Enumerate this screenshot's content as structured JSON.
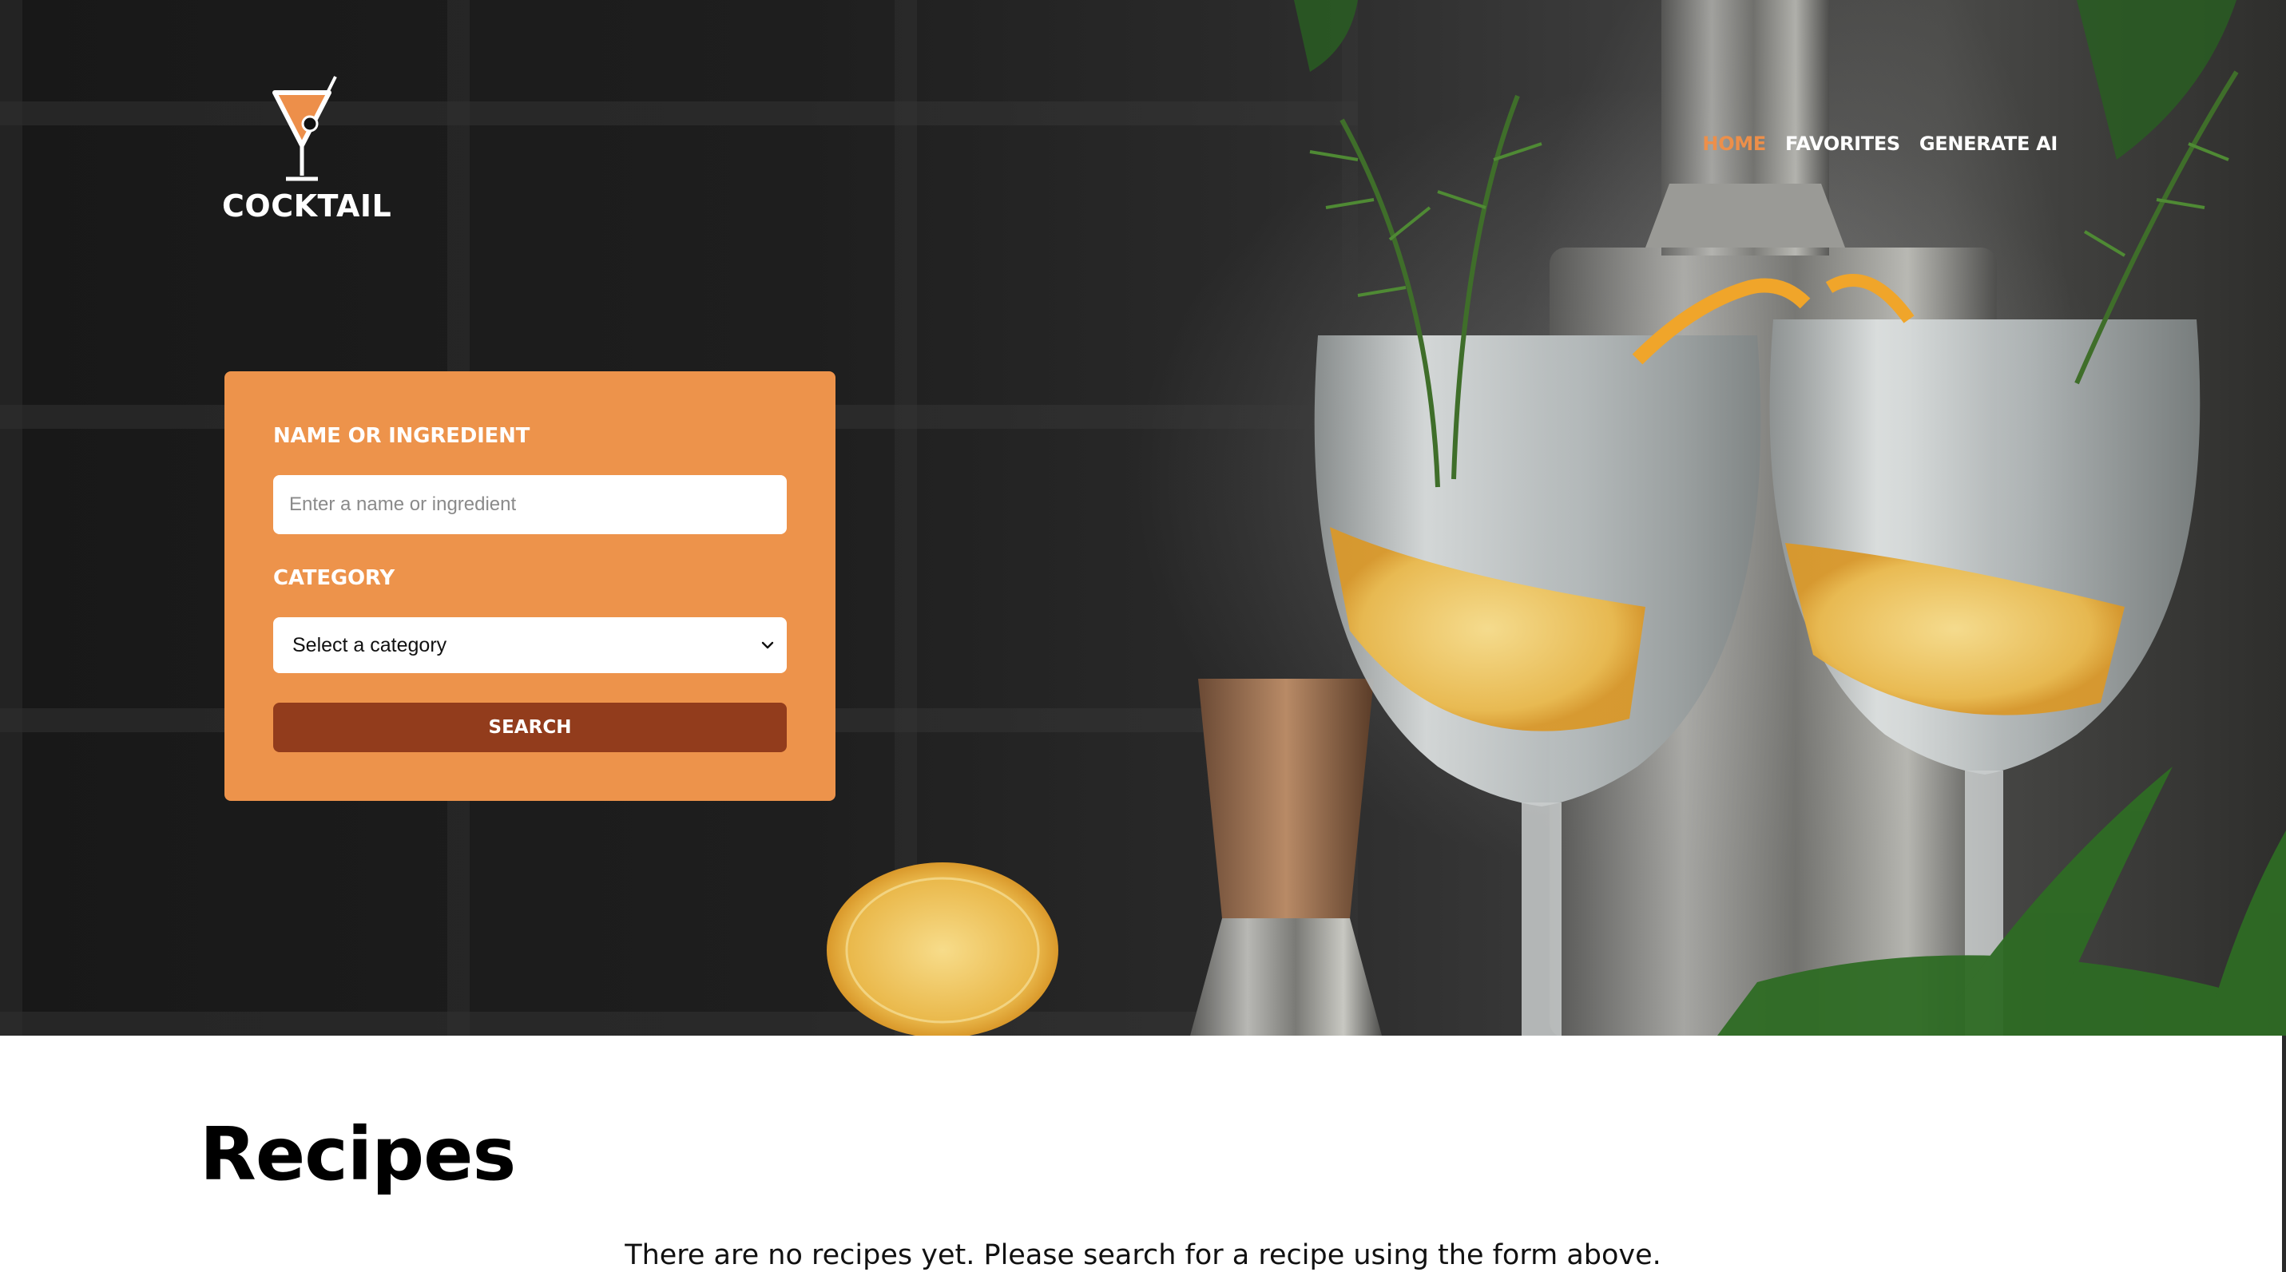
{
  "brand": {
    "name": "COCKTAIL",
    "logo_icon": "martini-glass-icon",
    "accent_color": "#ed8f4a"
  },
  "nav": {
    "items": [
      {
        "label": "HOME",
        "active": true
      },
      {
        "label": "FAVORITES",
        "active": false
      },
      {
        "label": "GENERATE AI",
        "active": false
      }
    ]
  },
  "search": {
    "name_label": "NAME OR INGREDIENT",
    "name_value": "",
    "name_placeholder": "Enter a name or ingredient",
    "category_label": "CATEGORY",
    "category_selected": "Select a category",
    "button_label": "SEARCH",
    "card_color": "#ed934b",
    "button_color": "#923c1c"
  },
  "main": {
    "title": "Recipes",
    "empty_message": "There are no recipes yet. Please search for a recipe using the form above."
  }
}
